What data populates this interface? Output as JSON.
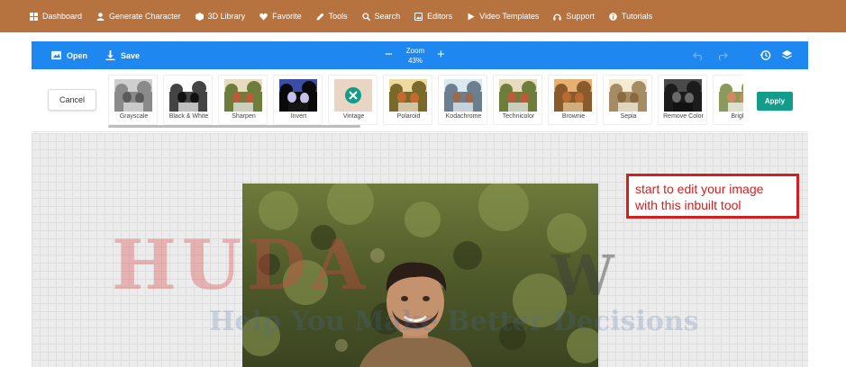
{
  "nav": {
    "items": [
      {
        "label": "Dashboard",
        "icon": "grid-icon"
      },
      {
        "label": "Generate Character",
        "icon": "person-icon"
      },
      {
        "label": "3D Library",
        "icon": "cube-icon"
      },
      {
        "label": "Favorite",
        "icon": "heart-icon"
      },
      {
        "label": "Tools",
        "icon": "pencil-icon"
      },
      {
        "label": "Search",
        "icon": "search-icon"
      },
      {
        "label": "Editors",
        "icon": "image-icon"
      },
      {
        "label": "Video Templates",
        "icon": "play-icon"
      },
      {
        "label": "Support",
        "icon": "headset-icon"
      },
      {
        "label": "Tutorials",
        "icon": "info-icon"
      }
    ]
  },
  "toolbar": {
    "open_label": "Open",
    "save_label": "Save",
    "zoom_label": "Zoom",
    "zoom_value": "43%",
    "zoom_minus": "−",
    "zoom_plus": "+"
  },
  "filterbar": {
    "cancel_label": "Cancel",
    "apply_label": "Apply",
    "filters": [
      {
        "label": "Grayscale",
        "style": "gray"
      },
      {
        "label": "Black & White",
        "style": "bw"
      },
      {
        "label": "Sharpen",
        "style": "color"
      },
      {
        "label": "Invert",
        "style": "invert"
      },
      {
        "label": "Vintage",
        "style": "vintage-selected"
      },
      {
        "label": "Polaroid",
        "style": "warm"
      },
      {
        "label": "Kodachrome",
        "style": "cool"
      },
      {
        "label": "Technicolor",
        "style": "color"
      },
      {
        "label": "Brownie",
        "style": "brown"
      },
      {
        "label": "Sepia",
        "style": "sepia"
      },
      {
        "label": "Remove Color",
        "style": "dark"
      },
      {
        "label": "Brigh",
        "style": "bright"
      }
    ]
  },
  "watermark": {
    "brand": "HUDA",
    "brand_end": "W",
    "tagline": "Help You Make Better Decisions"
  },
  "callout": {
    "line1": "start to edit your image",
    "line2": "with this inbuilt tool"
  },
  "colors": {
    "nav_bg": "#b7733f",
    "toolbar_bg": "#1e88f0",
    "apply_bg": "#139c8a",
    "callout_border": "#d21f1f"
  }
}
